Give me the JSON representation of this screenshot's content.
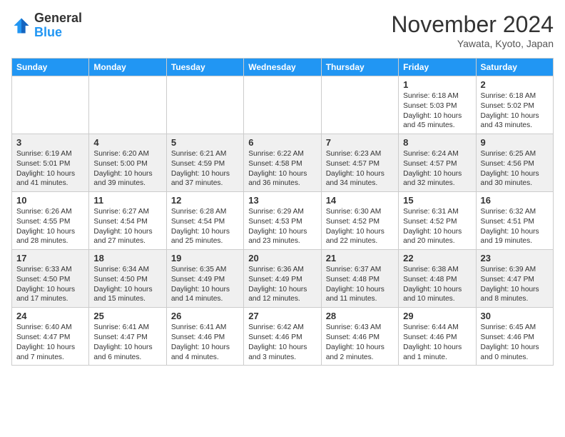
{
  "logo": {
    "general": "General",
    "blue": "Blue"
  },
  "title": "November 2024",
  "location": "Yawata, Kyoto, Japan",
  "weekdays": [
    "Sunday",
    "Monday",
    "Tuesday",
    "Wednesday",
    "Thursday",
    "Friday",
    "Saturday"
  ],
  "weeks": [
    [
      {
        "day": "",
        "content": ""
      },
      {
        "day": "",
        "content": ""
      },
      {
        "day": "",
        "content": ""
      },
      {
        "day": "",
        "content": ""
      },
      {
        "day": "",
        "content": ""
      },
      {
        "day": "1",
        "content": "Sunrise: 6:18 AM\nSunset: 5:03 PM\nDaylight: 10 hours\nand 45 minutes."
      },
      {
        "day": "2",
        "content": "Sunrise: 6:18 AM\nSunset: 5:02 PM\nDaylight: 10 hours\nand 43 minutes."
      }
    ],
    [
      {
        "day": "3",
        "content": "Sunrise: 6:19 AM\nSunset: 5:01 PM\nDaylight: 10 hours\nand 41 minutes."
      },
      {
        "day": "4",
        "content": "Sunrise: 6:20 AM\nSunset: 5:00 PM\nDaylight: 10 hours\nand 39 minutes."
      },
      {
        "day": "5",
        "content": "Sunrise: 6:21 AM\nSunset: 4:59 PM\nDaylight: 10 hours\nand 37 minutes."
      },
      {
        "day": "6",
        "content": "Sunrise: 6:22 AM\nSunset: 4:58 PM\nDaylight: 10 hours\nand 36 minutes."
      },
      {
        "day": "7",
        "content": "Sunrise: 6:23 AM\nSunset: 4:57 PM\nDaylight: 10 hours\nand 34 minutes."
      },
      {
        "day": "8",
        "content": "Sunrise: 6:24 AM\nSunset: 4:57 PM\nDaylight: 10 hours\nand 32 minutes."
      },
      {
        "day": "9",
        "content": "Sunrise: 6:25 AM\nSunset: 4:56 PM\nDaylight: 10 hours\nand 30 minutes."
      }
    ],
    [
      {
        "day": "10",
        "content": "Sunrise: 6:26 AM\nSunset: 4:55 PM\nDaylight: 10 hours\nand 28 minutes."
      },
      {
        "day": "11",
        "content": "Sunrise: 6:27 AM\nSunset: 4:54 PM\nDaylight: 10 hours\nand 27 minutes."
      },
      {
        "day": "12",
        "content": "Sunrise: 6:28 AM\nSunset: 4:54 PM\nDaylight: 10 hours\nand 25 minutes."
      },
      {
        "day": "13",
        "content": "Sunrise: 6:29 AM\nSunset: 4:53 PM\nDaylight: 10 hours\nand 23 minutes."
      },
      {
        "day": "14",
        "content": "Sunrise: 6:30 AM\nSunset: 4:52 PM\nDaylight: 10 hours\nand 22 minutes."
      },
      {
        "day": "15",
        "content": "Sunrise: 6:31 AM\nSunset: 4:52 PM\nDaylight: 10 hours\nand 20 minutes."
      },
      {
        "day": "16",
        "content": "Sunrise: 6:32 AM\nSunset: 4:51 PM\nDaylight: 10 hours\nand 19 minutes."
      }
    ],
    [
      {
        "day": "17",
        "content": "Sunrise: 6:33 AM\nSunset: 4:50 PM\nDaylight: 10 hours\nand 17 minutes."
      },
      {
        "day": "18",
        "content": "Sunrise: 6:34 AM\nSunset: 4:50 PM\nDaylight: 10 hours\nand 15 minutes."
      },
      {
        "day": "19",
        "content": "Sunrise: 6:35 AM\nSunset: 4:49 PM\nDaylight: 10 hours\nand 14 minutes."
      },
      {
        "day": "20",
        "content": "Sunrise: 6:36 AM\nSunset: 4:49 PM\nDaylight: 10 hours\nand 12 minutes."
      },
      {
        "day": "21",
        "content": "Sunrise: 6:37 AM\nSunset: 4:48 PM\nDaylight: 10 hours\nand 11 minutes."
      },
      {
        "day": "22",
        "content": "Sunrise: 6:38 AM\nSunset: 4:48 PM\nDaylight: 10 hours\nand 10 minutes."
      },
      {
        "day": "23",
        "content": "Sunrise: 6:39 AM\nSunset: 4:47 PM\nDaylight: 10 hours\nand 8 minutes."
      }
    ],
    [
      {
        "day": "24",
        "content": "Sunrise: 6:40 AM\nSunset: 4:47 PM\nDaylight: 10 hours\nand 7 minutes."
      },
      {
        "day": "25",
        "content": "Sunrise: 6:41 AM\nSunset: 4:47 PM\nDaylight: 10 hours\nand 6 minutes."
      },
      {
        "day": "26",
        "content": "Sunrise: 6:41 AM\nSunset: 4:46 PM\nDaylight: 10 hours\nand 4 minutes."
      },
      {
        "day": "27",
        "content": "Sunrise: 6:42 AM\nSunset: 4:46 PM\nDaylight: 10 hours\nand 3 minutes."
      },
      {
        "day": "28",
        "content": "Sunrise: 6:43 AM\nSunset: 4:46 PM\nDaylight: 10 hours\nand 2 minutes."
      },
      {
        "day": "29",
        "content": "Sunrise: 6:44 AM\nSunset: 4:46 PM\nDaylight: 10 hours\nand 1 minute."
      },
      {
        "day": "30",
        "content": "Sunrise: 6:45 AM\nSunset: 4:46 PM\nDaylight: 10 hours\nand 0 minutes."
      }
    ]
  ]
}
